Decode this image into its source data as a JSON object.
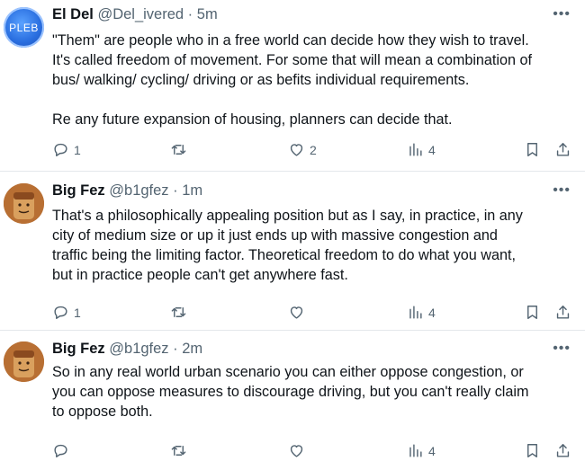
{
  "tweets": [
    {
      "avatar_text": "PLEB",
      "name": "El Del",
      "handle": "@Del_ivered",
      "separator": "·",
      "time": "5m",
      "more_label": "•••",
      "paragraphs": [
        "\"Them\" are people who in a free world can decide how they wish to travel.\nIt's called freedom of movement. For some that will mean a combination of\nbus/ walking/ cycling/ driving or as befits individual requirements.",
        "Re any future expansion of housing, planners can decide that."
      ],
      "replies": "1",
      "reposts": "",
      "likes": "2",
      "views": "4"
    },
    {
      "avatar_text": "",
      "name": "Big Fez",
      "handle": "@b1gfez",
      "separator": "·",
      "time": "1m",
      "more_label": "•••",
      "paragraphs": [
        "That's a philosophically appealing position but as I say, in practice, in any\ncity of medium size or up it just ends up with massive congestion and\ntraffic being the limiting factor. Theoretical freedom to do what you want,\nbut in practice people can't get anywhere fast."
      ],
      "replies": "1",
      "reposts": "",
      "likes": "",
      "views": "4"
    },
    {
      "avatar_text": "",
      "name": "Big Fez",
      "handle": "@b1gfez",
      "separator": "·",
      "time": "2m",
      "more_label": "•••",
      "paragraphs": [
        "So in any real world urban scenario you can either oppose congestion, or\nyou can oppose measures to discourage driving, but you can't really claim\nto oppose both."
      ],
      "replies": "",
      "reposts": "",
      "likes": "",
      "views": "4"
    }
  ],
  "icons": {
    "reply": "reply-icon",
    "repost": "repost-icon",
    "like": "like-icon",
    "views": "views-icon",
    "bookmark": "bookmark-icon",
    "share": "share-icon",
    "more": "more-icon"
  },
  "colors": {
    "text": "#0f1419",
    "secondary": "#536471",
    "divider": "#e4e8eb",
    "pleb_avatar": "#2a6fe0",
    "fez_avatar": "#b46a2c"
  }
}
